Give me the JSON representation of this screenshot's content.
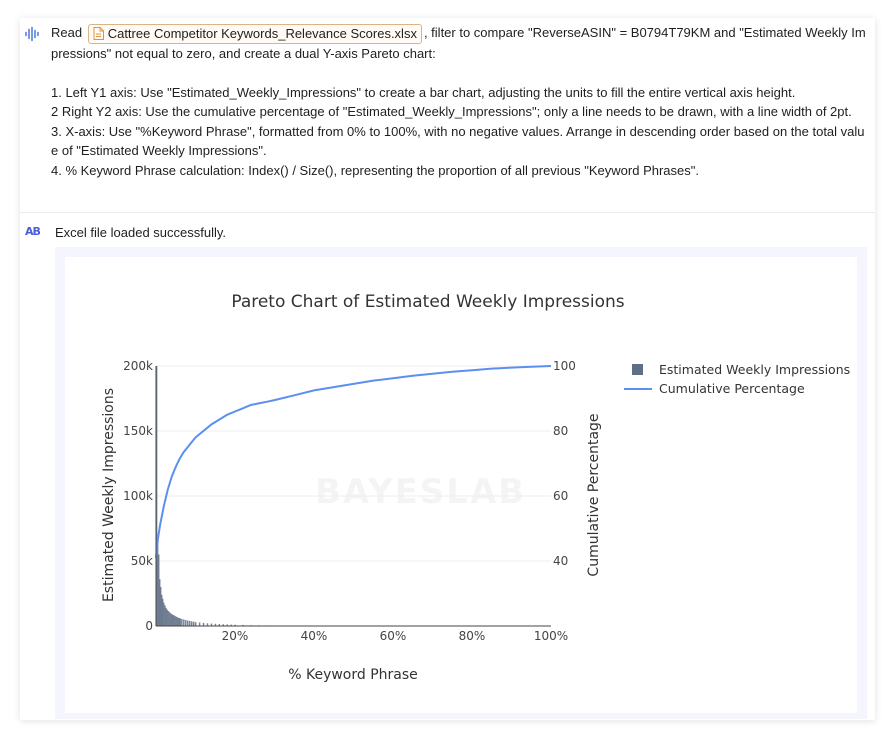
{
  "user_message": {
    "read_word": "Read",
    "file_name": "Cattree Competitor Keywords_Relevance Scores.xlsx",
    "line1_rest": ", filter to compare \"ReverseASIN\" = B0794T79KM and \"Estimated Weekly Impressions\" not equal to zero, and create a dual Y-axis Pareto chart:",
    "items": [
      "1. Left Y1 axis: Use \"Estimated_Weekly_Impressions\" to create a bar chart, adjusting the units to fill the entire vertical axis height.",
      "2 Right Y2 axis: Use the cumulative percentage of \"Estimated_Weekly_Impressions\"; only a line needs to be drawn, with a line width of 2pt.",
      "3. X-axis: Use \"%Keyword Phrase\", formatted from 0% to 100%, with no negative values. Arrange in descending order based on the total value of \"Estimated Weekly Impressions\".",
      "4. % Keyword Phrase calculation: Index() / Size(), representing the proportion of all previous \"Keyword Phrases\"."
    ]
  },
  "assistant": {
    "logo_text": "AB",
    "message": "Excel file loaded successfully."
  },
  "watermark": "BAYESLAB",
  "colors": {
    "bar": "#5f6f86",
    "line": "#5b8ff0",
    "file_chip_border": "#d9b48a",
    "logo": "#4b5dd6"
  },
  "chart_data": {
    "type": "bar",
    "title": "Pareto Chart of Estimated Weekly Impressions",
    "xlabel": "% Keyword Phrase",
    "ylabel": "Estimated Weekly Impressions",
    "y2label": "Cumulative Percentage",
    "x_ticks": [
      "20%",
      "40%",
      "60%",
      "80%",
      "100%"
    ],
    "x_range": [
      0,
      100
    ],
    "y_ticks": [
      "0",
      "50k",
      "100k",
      "150k",
      "200k"
    ],
    "y_range": [
      0,
      200000
    ],
    "y2_ticks": [
      "40",
      "60",
      "80",
      "100"
    ],
    "y2_range": [
      20,
      100
    ],
    "legend_position": "top-right",
    "series": [
      {
        "name": "Estimated Weekly Impressions",
        "type": "bar",
        "x": [
          0.12,
          0.38,
          0.65,
          0.9,
          1.15,
          1.4,
          1.65,
          1.9,
          2.2,
          2.5,
          2.8,
          3.1,
          3.4,
          3.7,
          4.0,
          4.3,
          4.6,
          4.9,
          5.2,
          5.5,
          5.8,
          6.1,
          6.5,
          7,
          7.5,
          8,
          8.5,
          9,
          9.5,
          10,
          11,
          12,
          13,
          14,
          15,
          16,
          17,
          18,
          19,
          20,
          22,
          24,
          26,
          28,
          30,
          33,
          36,
          40
        ],
        "values": [
          200000,
          65000,
          55000,
          36000,
          30000,
          24000,
          21000,
          18000,
          16000,
          14000,
          12500,
          11500,
          10500,
          9800,
          9000,
          8500,
          8000,
          7500,
          7000,
          6500,
          6200,
          5800,
          5500,
          5000,
          4600,
          4200,
          3900,
          3600,
          3300,
          3000,
          2700,
          2400,
          2100,
          1900,
          1700,
          1500,
          1350,
          1200,
          1050,
          950,
          800,
          650,
          550,
          450,
          380,
          300,
          220,
          150
        ]
      },
      {
        "name": "Cumulative Percentage",
        "type": "line",
        "x": [
          0,
          0.5,
          1,
          2,
          3,
          4,
          5,
          6,
          7,
          8,
          9,
          10,
          12,
          14,
          16,
          18,
          20,
          22,
          24,
          26,
          28,
          30,
          35,
          40,
          45,
          50,
          55,
          60,
          65,
          70,
          75,
          80,
          85,
          90,
          95,
          100
        ],
        "values": [
          41,
          47,
          51,
          57,
          62,
          66,
          69,
          71.5,
          73.5,
          75,
          76.5,
          78,
          80,
          82,
          83.5,
          85,
          86,
          87,
          88,
          88.5,
          89,
          89.5,
          91,
          92.5,
          93.5,
          94.5,
          95.5,
          96.2,
          97,
          97.6,
          98.2,
          98.7,
          99.2,
          99.5,
          99.8,
          100
        ]
      }
    ]
  }
}
